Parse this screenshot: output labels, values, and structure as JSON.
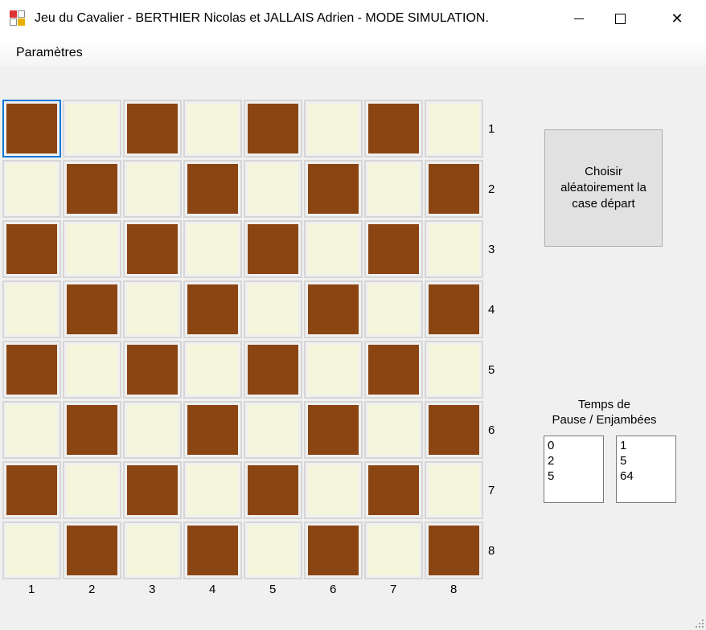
{
  "window": {
    "title": "Jeu du Cavalier - BERTHIER Nicolas et JALLAIS Adrien - MODE SIMULATION.",
    "minimize_icon": "minimize-icon",
    "maximize_icon": "maximize-icon",
    "close_icon": "close-icon",
    "close_glyph": "✕"
  },
  "menu": {
    "items": [
      "Paramètres"
    ]
  },
  "board": {
    "dark_color": "#8b4513",
    "light_color": "#f5f5dc",
    "selected_cell": "1-1",
    "row_labels": [
      "1",
      "2",
      "3",
      "4",
      "5",
      "6",
      "7",
      "8"
    ],
    "col_labels": [
      "1",
      "2",
      "3",
      "4",
      "5",
      "6",
      "7",
      "8"
    ]
  },
  "random_start_button": {
    "label": "Choisir aléatoirement la case départ"
  },
  "settings": {
    "label_line1": "Temps de",
    "label_line2": "Pause / Enjambées",
    "pause_values": [
      "0",
      "2",
      "5"
    ],
    "steps_values": [
      "1",
      "5",
      "64"
    ]
  }
}
